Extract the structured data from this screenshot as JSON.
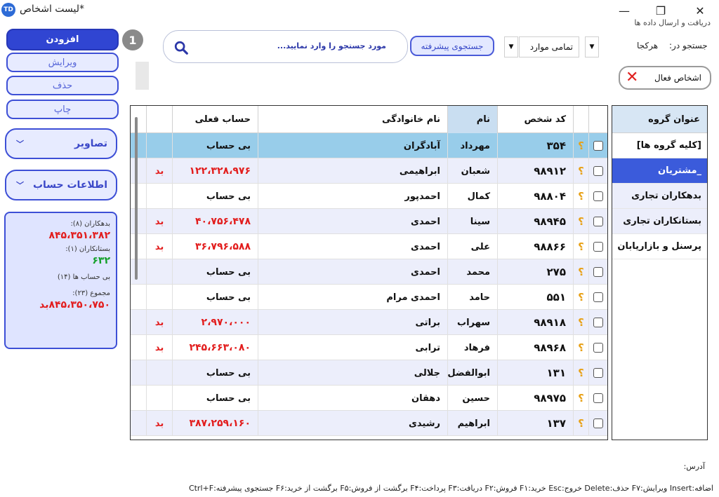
{
  "window": {
    "title": "لیست اشخاص*",
    "app_icon": "TD",
    "minimize_icon": "—",
    "maximize_icon": "❐",
    "close_icon": "✕",
    "sync_label": "دریافت و ارسال داده ها"
  },
  "commands": {
    "add": "افزودن",
    "edit": "ویرایش",
    "delete": "حذف",
    "print": "چاپ",
    "step_badge": "1",
    "images": "تصاویر",
    "account_info": "اطلاعات حساب"
  },
  "summary": {
    "debtors_label": "بدهکاران (۸):",
    "debtors_value": "۸۴۵،۳۵۱،۳۸۲",
    "creditors_label": "بستانکاران (۱):",
    "creditors_value": "۶۳۲",
    "no_account_label": "بی حساب ها (۱۴)",
    "total_label": "مجموع (۲۳):",
    "total_value": "۸۴۵،۳۵۰،۷۵۰بد"
  },
  "search": {
    "placeholder": "مورد جستجو را وارد نمایید...",
    "advanced_button": "جستجوی پیشرفته",
    "scope_value": "تمامی موارد",
    "search_in_label": "جستجو در:",
    "search_in_value": "هرکجا",
    "active_persons_button": "اشخاص فعال"
  },
  "table": {
    "headers": {
      "code": "کد شخص",
      "name": "نام",
      "family": "نام خانوادگی",
      "account": "حساب فعلی"
    },
    "rows": [
      {
        "code": "۳۵۴",
        "name": "مهرداد",
        "family": "آبادگران",
        "account": "بی حساب",
        "status": "",
        "debt": false,
        "selected": true
      },
      {
        "code": "۹۸۹۱۲",
        "name": "شعبان",
        "family": "ابراهیمی",
        "account": "۱۲۲،۳۲۸،۹۷۶",
        "status": "بد",
        "debt": true,
        "selected": false
      },
      {
        "code": "۹۸۸۰۴",
        "name": "کمال",
        "family": "احمدپور",
        "account": "بی حساب",
        "status": "",
        "debt": false,
        "selected": false
      },
      {
        "code": "۹۸۹۴۵",
        "name": "سینا",
        "family": "احمدی",
        "account": "۴۰،۷۵۶،۴۷۸",
        "status": "بد",
        "debt": true,
        "selected": false
      },
      {
        "code": "۹۸۸۶۶",
        "name": "علی",
        "family": "احمدی",
        "account": "۳۶،۷۹۶،۵۸۸",
        "status": "بد",
        "debt": true,
        "selected": false
      },
      {
        "code": "۲۷۵",
        "name": "محمد",
        "family": "احمدی",
        "account": "بی حساب",
        "status": "",
        "debt": false,
        "selected": false
      },
      {
        "code": "۵۵۱",
        "name": "حامد",
        "family": "احمدی مرام",
        "account": "بی حساب",
        "status": "",
        "debt": false,
        "selected": false
      },
      {
        "code": "۹۸۹۱۸",
        "name": "سهراب",
        "family": "براتی",
        "account": "۲،۹۷۰،۰۰۰",
        "status": "بد",
        "debt": true,
        "selected": false
      },
      {
        "code": "۹۸۹۶۸",
        "name": "فرهاد",
        "family": "ترابی",
        "account": "۲۴۵،۶۶۳،۰۸۰",
        "status": "بد",
        "debt": true,
        "selected": false
      },
      {
        "code": "۱۳۱",
        "name": "ابوالفضل",
        "family": "جلالی",
        "account": "بی حساب",
        "status": "",
        "debt": false,
        "selected": false
      },
      {
        "code": "۹۸۹۷۵",
        "name": "حسین",
        "family": "دهقان",
        "account": "بی حساب",
        "status": "",
        "debt": false,
        "selected": false
      },
      {
        "code": "۱۳۷",
        "name": "ابراهیم",
        "family": "رشیدی",
        "account": "۳۸۷،۲۵۹،۱۶۰",
        "status": "بد",
        "debt": true,
        "selected": false
      }
    ],
    "row_icon": "؟"
  },
  "groups": {
    "header": "عنوان گروه",
    "items": [
      "[کلیه گروه ها]",
      "_مشتریان",
      "بدهکاران تجاری",
      "بستانکاران تجاری",
      "پرسنل و بازاریابان"
    ],
    "selected_index": 1
  },
  "footer": {
    "address_label": "آدرس:",
    "shortcuts": "اضافه:Insert  ویرایش:F۷  حذف:Delete  خروج:Esc  خرید:F۱  فروش:F۲  دریافت:F۳  پرداخت:F۴  برگشت از فروش:F۵  برگشت از خرید:F۶  جستجوی پیشرفته:Ctrl+F"
  },
  "colors": {
    "accent": "#3045d2",
    "selected_row": "#98cdea",
    "debt_red": "#e21d1d",
    "credit_green": "#14a02b"
  }
}
